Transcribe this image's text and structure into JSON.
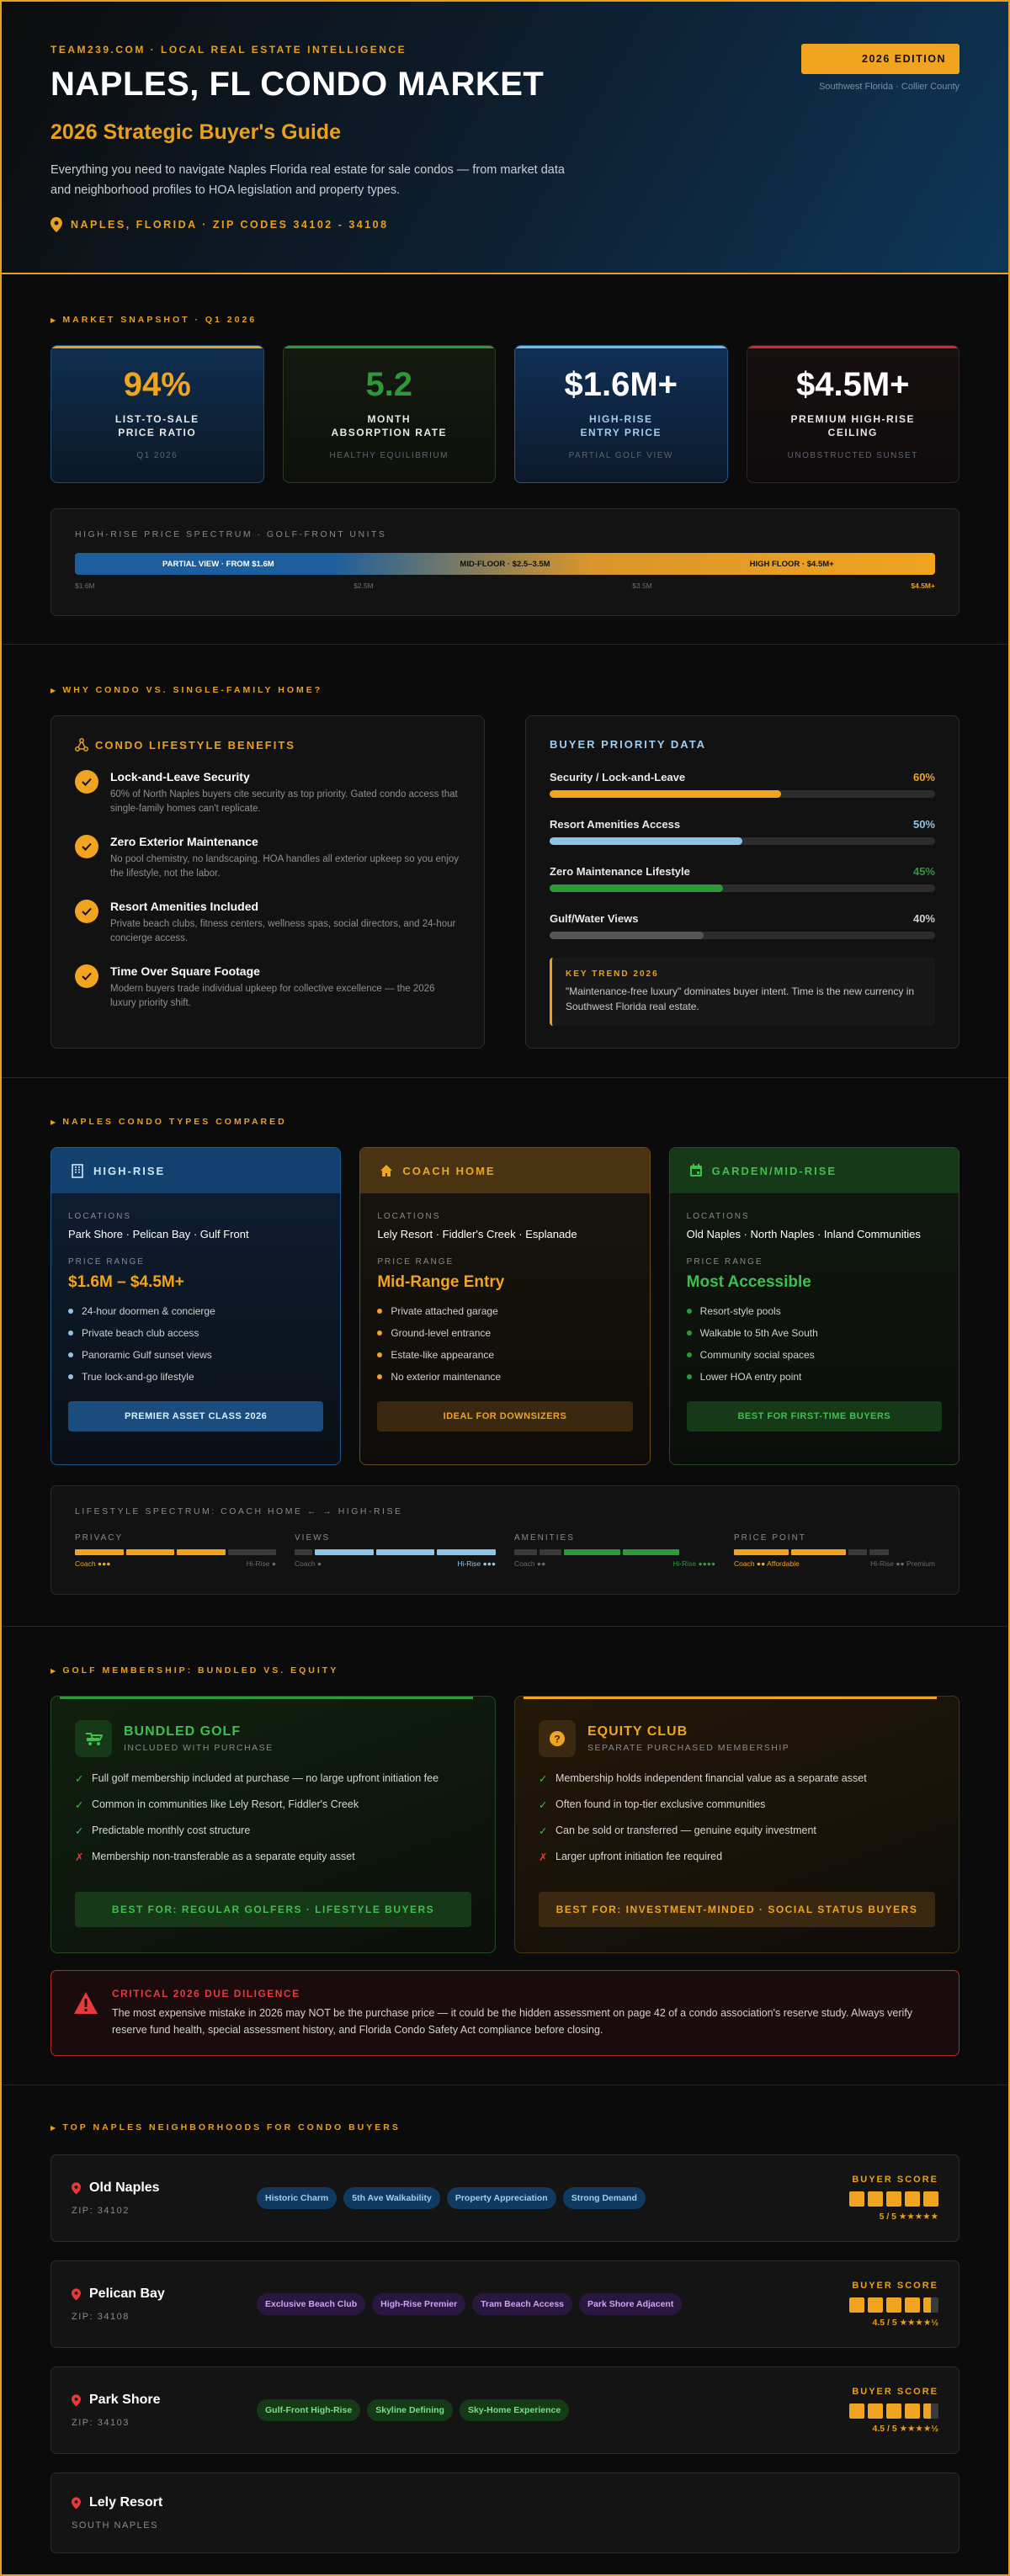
{
  "hero": {
    "kicker": "TEAM239.COM · LOCAL REAL ESTATE INTELLIGENCE",
    "title": "NAPLES, FL CONDO MARKET",
    "subtitle": "2026 Strategic Buyer's Guide",
    "description": "Everything you need to navigate Naples Florida real estate for sale condos — from market data and neighborhood profiles to HOA legislation and property types.",
    "location": "NAPLES, FLORIDA · ZIP CODES 34102 - 34108",
    "edition": "2026 EDITION",
    "edition_sub": "Southwest Florida · Collier County"
  },
  "snapshot": {
    "label": "MARKET SNAPSHOT · Q1 2026",
    "cards": [
      {
        "value": "94%",
        "label1": "LIST-TO-SALE",
        "label2": "PRICE RATIO",
        "note": "Q1 2026",
        "color": "#f0a41f"
      },
      {
        "value": "5.2",
        "label1": "MONTH",
        "label2": "ABSORPTION RATE",
        "note": "HEALTHY EQUILIBRIUM",
        "color": "#2d9a3a"
      },
      {
        "value": "$1.6M+",
        "label1": "HIGH-RISE",
        "label2": "ENTRY PRICE",
        "note": "PARTIAL GOLF VIEW",
        "color": "#ffffff"
      },
      {
        "value": "$4.5M+",
        "label1": "PREMIUM HIGH-RISE",
        "label2": "CEILING",
        "note": "UNOBSTRUCTED SUNSET",
        "color": "#ffffff"
      }
    ],
    "spectrum": {
      "title": "HIGH-RISE PRICE SPECTRUM · GOLF-FRONT UNITS",
      "segments": [
        "PARTIAL VIEW · FROM $1.6M",
        "MID-FLOOR · $2.5–3.5M",
        "HIGH FLOOR · $4.5M+"
      ],
      "ticks": [
        "$1.6M",
        "$2.5M",
        "$3.5M",
        "$4.5M+"
      ]
    }
  },
  "why": {
    "label": "WHY CONDO VS. SINGLE-FAMILY HOME?",
    "benefits_title": "CONDO LIFESTYLE BENEFITS",
    "benefits": [
      {
        "title": "Lock-and-Leave Security",
        "text": "60% of North Naples buyers cite security as top priority. Gated condo access that single-family homes can't replicate."
      },
      {
        "title": "Zero Exterior Maintenance",
        "text": "No pool chemistry, no landscaping. HOA handles all exterior upkeep so you enjoy the lifestyle, not the labor."
      },
      {
        "title": "Resort Amenities Included",
        "text": "Private beach clubs, fitness centers, wellness spas, social directors, and 24-hour concierge access."
      },
      {
        "title": "Time Over Square Footage",
        "text": "Modern buyers trade individual upkeep for collective excellence — the 2026 luxury priority shift."
      }
    ],
    "priority_title": "BUYER PRIORITY DATA",
    "priorities": [
      {
        "name": "Security / Lock-and-Leave",
        "value": 60,
        "display": "60%",
        "color": "#f0a41f"
      },
      {
        "name": "Resort Amenities Access",
        "value": 50,
        "display": "50%",
        "color": "#8ec5e6"
      },
      {
        "name": "Zero Maintenance Lifestyle",
        "value": 45,
        "display": "45%",
        "color": "#2d9a3a"
      },
      {
        "name": "Gulf/Water Views",
        "value": 40,
        "display": "40%",
        "color": "#555555"
      }
    ],
    "trend_label": "KEY TREND 2026",
    "trend_text": "\"Maintenance-free luxury\" dominates buyer intent. Time is the new currency in Southwest Florida real estate."
  },
  "types": {
    "label": "NAPLES CONDO TYPES COMPARED",
    "loc_label": "LOCATIONS",
    "price_label": "PRICE RANGE",
    "cards": [
      {
        "name": "HIGH-RISE",
        "locations": "Park Shore · Pelican Bay · Gulf Front",
        "price": "$1.6M – $4.5M+",
        "features": [
          "24-hour doormen & concierge",
          "Private beach club access",
          "Panoramic Gulf sunset views",
          "True lock-and-go lifestyle"
        ],
        "footer": "PREMIER ASSET CLASS 2026"
      },
      {
        "name": "COACH HOME",
        "locations": "Lely Resort · Fiddler's Creek · Esplanade",
        "price": "Mid-Range Entry",
        "features": [
          "Private attached garage",
          "Ground-level entrance",
          "Estate-like appearance",
          "No exterior maintenance"
        ],
        "footer": "IDEAL FOR DOWNSIZERS"
      },
      {
        "name": "GARDEN/MID-RISE",
        "locations": "Old Naples · North Naples · Inland Communities",
        "price": "Most Accessible",
        "features": [
          "Resort-style pools",
          "Walkable to 5th Ave South",
          "Community social spaces",
          "Lower HOA entry point"
        ],
        "footer": "BEST FOR FIRST-TIME BUYERS"
      }
    ],
    "spectrum_title": "LIFESTYLE SPECTRUM: COACH HOME ← → HIGH-RISE",
    "spectrum": [
      {
        "name": "PRIVACY",
        "left": "Coach ●●●",
        "right": "Hi-Rise ●"
      },
      {
        "name": "VIEWS",
        "left": "Coach ●",
        "right": "Hi-Rise ●●●"
      },
      {
        "name": "AMENITIES",
        "left": "Coach ●●",
        "right": "Hi-Rise ●●●●"
      },
      {
        "name": "PRICE POINT",
        "left": "Coach ●● Affordable",
        "right": "Hi-Rise ●● Premium"
      }
    ]
  },
  "golf": {
    "label": "GOLF MEMBERSHIP: BUNDLED VS. EQUITY",
    "bundled": {
      "title": "BUNDLED GOLF",
      "sub": "INCLUDED WITH PURCHASE",
      "items": [
        {
          "mark": "✓",
          "text": "Full golf membership included at purchase — no large upfront initiation fee"
        },
        {
          "mark": "✓",
          "text": "Common in communities like Lely Resort, Fiddler's Creek"
        },
        {
          "mark": "✓",
          "text": "Predictable monthly cost structure"
        },
        {
          "mark": "✗",
          "text": "Membership non-transferable as a separate equity asset"
        }
      ],
      "footer": "BEST FOR: REGULAR GOLFERS · LIFESTYLE BUYERS"
    },
    "equity": {
      "title": "EQUITY CLUB",
      "sub": "SEPARATE PURCHASED MEMBERSHIP",
      "items": [
        {
          "mark": "✓",
          "text": "Membership holds independent financial value as a separate asset"
        },
        {
          "mark": "✓",
          "text": "Often found in top-tier exclusive communities"
        },
        {
          "mark": "✓",
          "text": "Can be sold or transferred — genuine equity investment"
        },
        {
          "mark": "✗",
          "text": "Larger upfront initiation fee required"
        }
      ],
      "footer": "BEST FOR: INVESTMENT-MINDED · SOCIAL STATUS BUYERS"
    },
    "alert_title": "CRITICAL 2026 DUE DILIGENCE",
    "alert_text": "The most expensive mistake in 2026 may NOT be the purchase price — it could be the hidden assessment on page 42 of a condo association's reserve study. Always verify reserve fund health, special assessment history, and Florida Condo Safety Act compliance before closing."
  },
  "neighborhoods": {
    "label": "TOP NAPLES NEIGHBORHOODS FOR CONDO BUYERS",
    "score_label": "BUYER SCORE",
    "items": [
      {
        "name": "Old Naples",
        "zip": "ZIP: 34102",
        "tags": [
          "Historic Charm",
          "5th Ave Walkability",
          "Property Appreciation",
          "Strong Demand"
        ],
        "score": 5,
        "score_text": "5 / 5 ★★★★★",
        "theme": "blue"
      },
      {
        "name": "Pelican Bay",
        "zip": "ZIP: 34108",
        "tags": [
          "Exclusive Beach Club",
          "High-Rise Premier",
          "Tram Beach Access",
          "Park Shore Adjacent"
        ],
        "score": 4.5,
        "score_text": "4.5 / 5 ★★★★½",
        "theme": "purple"
      },
      {
        "name": "Park Shore",
        "zip": "ZIP: 34103",
        "tags": [
          "Gulf-Front High-Rise",
          "Skyline Defining",
          "Sky-Home Experience"
        ],
        "score": 4.5,
        "score_text": "4.5 / 5 ★★★★½",
        "theme": "green"
      },
      {
        "name": "Lely Resort",
        "zip": "SOUTH NAPLES",
        "tags": [],
        "score": null,
        "score_text": "",
        "theme": "none"
      }
    ]
  }
}
